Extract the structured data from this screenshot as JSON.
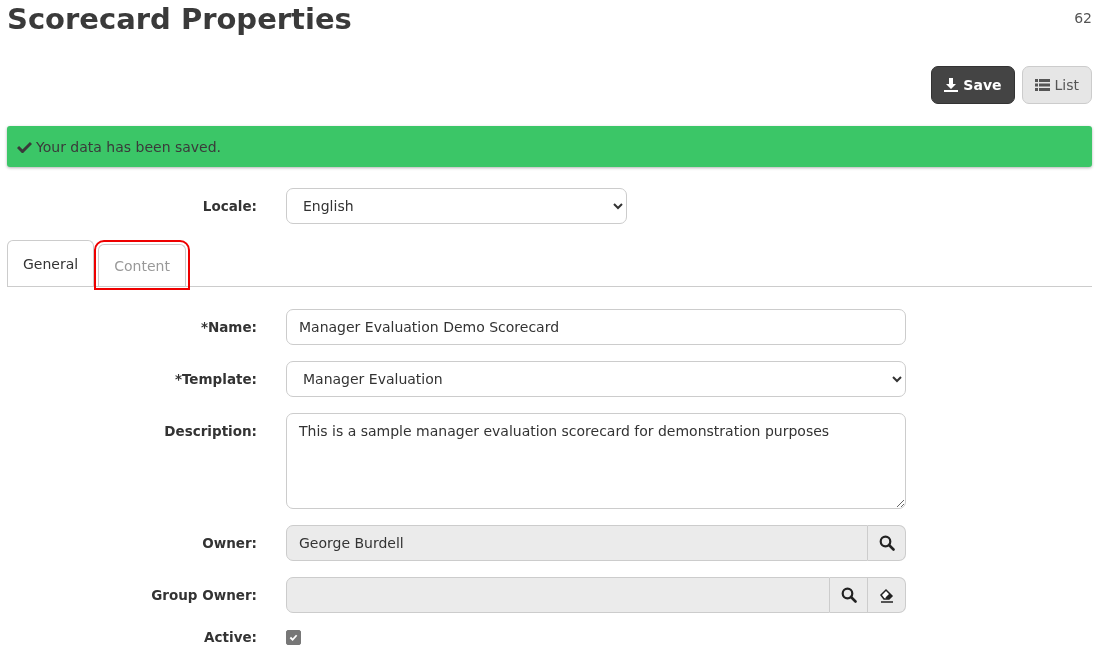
{
  "page": {
    "title": "Scorecard Properties",
    "record_id": "62"
  },
  "toolbar": [
    {
      "label": "Save",
      "kind": "primary"
    },
    {
      "label": "List",
      "kind": "secondary"
    }
  ],
  "alert": {
    "message": "Your data has been saved."
  },
  "locale": {
    "label": "Locale:",
    "value": "English"
  },
  "tabs": [
    {
      "label": "General",
      "selected": true,
      "highlighted": false
    },
    {
      "label": "Content",
      "selected": false,
      "highlighted": true
    }
  ],
  "fields": [
    {
      "label": "*Name:",
      "kind": "input",
      "value": "Manager Evaluation Demo Scorecard"
    },
    {
      "label": "*Template:",
      "kind": "select",
      "value": "Manager Evaluation"
    },
    {
      "label": "Description:",
      "kind": "textarea",
      "value": "This is a sample manager evaluation scorecard for demonstration purposes"
    },
    {
      "label": "Owner:",
      "kind": "lookup",
      "value": "George Burdell",
      "clearable": false
    },
    {
      "label": "Group Owner:",
      "kind": "lookup",
      "clearable": true
    },
    {
      "label": "Active:",
      "kind": "checkbox",
      "checked": true
    }
  ]
}
